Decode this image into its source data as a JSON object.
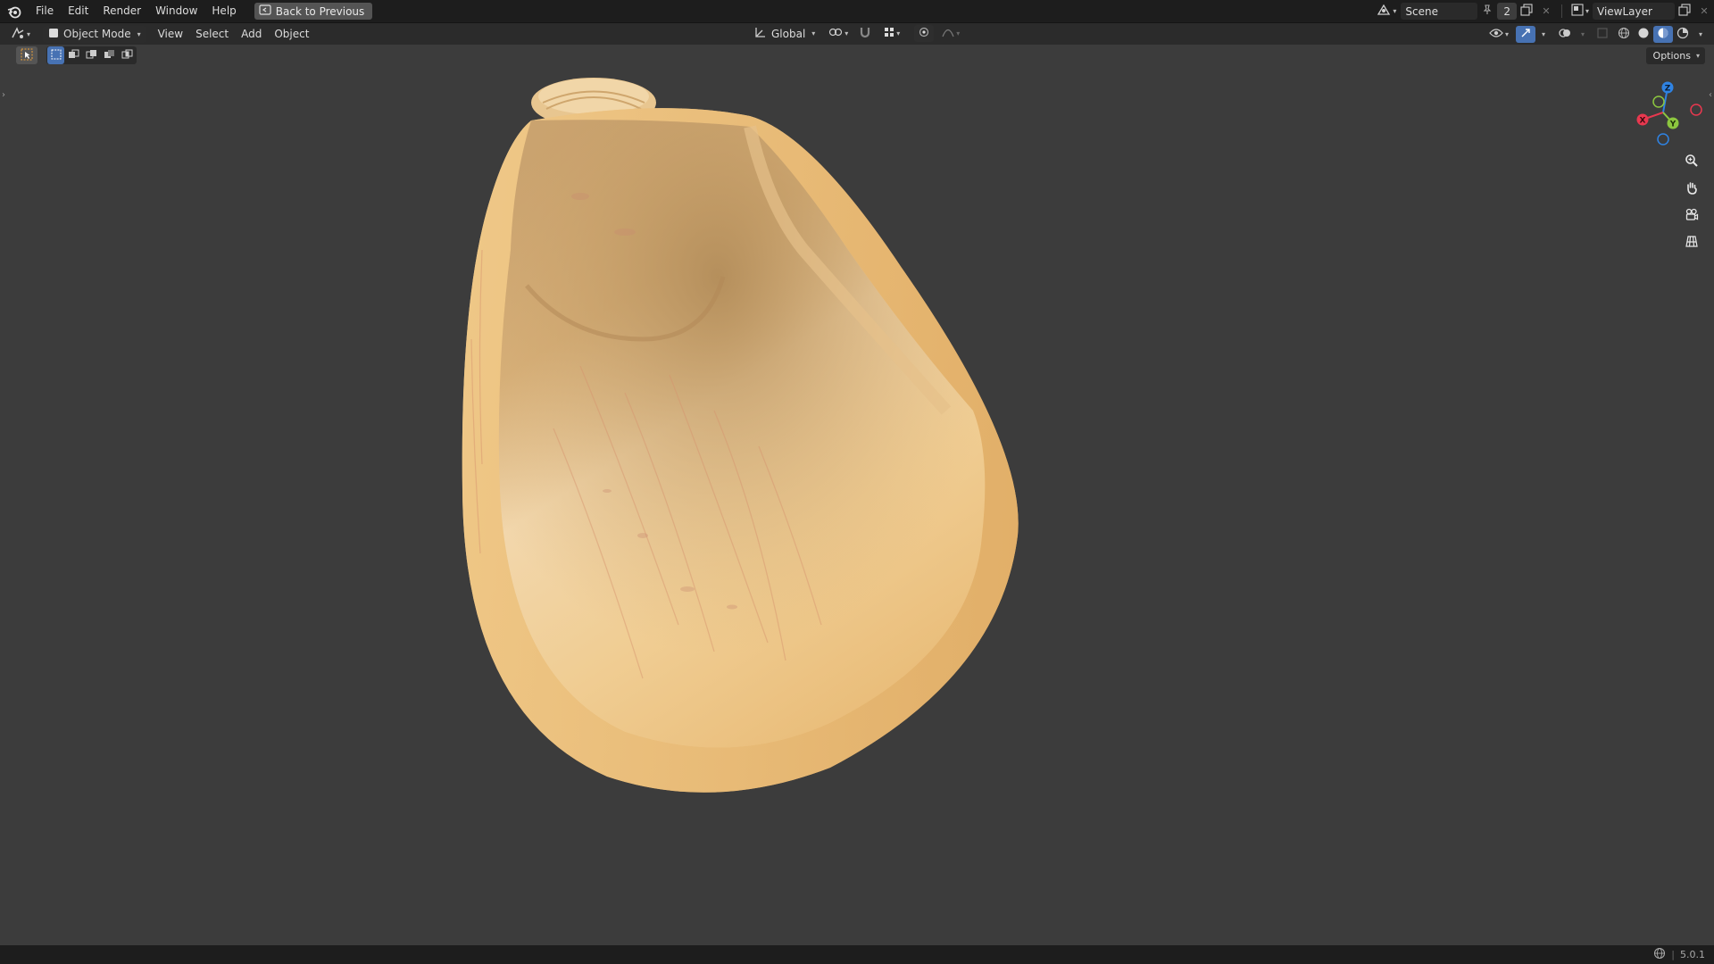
{
  "topbar": {
    "menu": [
      "File",
      "Edit",
      "Render",
      "Window",
      "Help"
    ],
    "back_label": "Back to Previous",
    "scene_name": "Scene",
    "scene_users": "2",
    "viewlayer_name": "ViewLayer"
  },
  "header": {
    "mode": "Object Mode",
    "menu": [
      "View",
      "Select",
      "Add",
      "Object"
    ],
    "transform_orientation": "Global"
  },
  "viewport": {
    "options_label": "Options",
    "gizmo": {
      "x": "X",
      "y": "Y",
      "z": "Z"
    }
  },
  "statusbar": {
    "version": "5.0.1"
  },
  "colors": {
    "accent": "#4772b3",
    "axis_x": "#e8384f",
    "axis_y": "#8cc63f",
    "axis_z": "#2f83e3",
    "wood_light": "#f1d2a0",
    "wood_dark": "#d8a560"
  },
  "icons": {
    "editor_type": "viewport-icon",
    "snap": "magnet-icon",
    "proportional": "proportional-edit-icon",
    "zoom": "zoom-icon",
    "pan": "hand-icon",
    "camera": "camera-icon",
    "ortho": "grid-icon"
  }
}
